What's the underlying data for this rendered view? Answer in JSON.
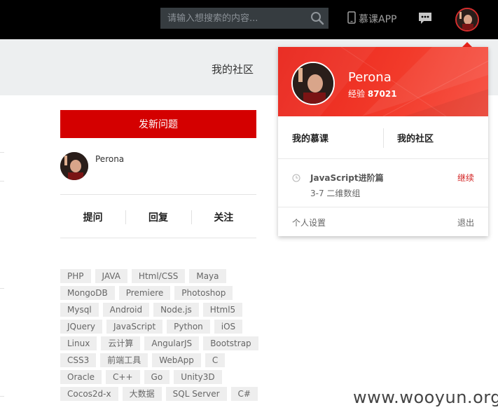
{
  "header": {
    "search_placeholder": "请输入想搜索的内容...",
    "app_label": "慕课APP"
  },
  "community": {
    "title": "我的社区",
    "new_question": "发新问题",
    "user_name": "Perona",
    "stats": [
      "提问",
      "回复",
      "关注"
    ],
    "tags": [
      "PHP",
      "JAVA",
      "Html/CSS",
      "Maya",
      "MongoDB",
      "Premiere",
      "Photoshop",
      "Mysql",
      "Android",
      "Node.js",
      "Html5",
      "JQuery",
      "JavaScript",
      "Python",
      "iOS",
      "Linux",
      "云计算",
      "AngularJS",
      "Bootstrap",
      "CSS3",
      "前端工具",
      "WebApp",
      "C",
      "Oracle",
      "C++",
      "Go",
      "Unity3D",
      "Cocos2d-x",
      "大数据",
      "SQL Server",
      "C#"
    ]
  },
  "dropdown": {
    "name": "Perona",
    "exp_label": "经验",
    "exp_value": "87021",
    "links": [
      "我的慕课",
      "我的社区"
    ],
    "course_title": "JavaScript进阶篇",
    "course_sub": "3-7 二维数组",
    "continue": "继续",
    "settings": "个人设置",
    "logout": "退出"
  },
  "watermark": "www.wooyun.org",
  "colors": {
    "topbar": "#000000",
    "accent_red": "#d40000",
    "dropdown_header": "#e8231a"
  }
}
